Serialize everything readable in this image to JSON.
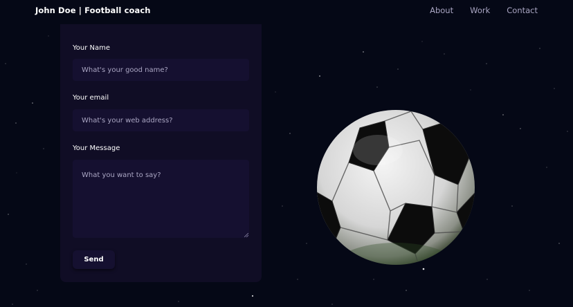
{
  "navbar": {
    "brand": "John Doe  | Football coach",
    "links": [
      "About",
      "Work",
      "Contact"
    ]
  },
  "form": {
    "name": {
      "label": "Your Name",
      "placeholder": "What's your good name?"
    },
    "email": {
      "label": "Your email",
      "placeholder": "What's your web address?"
    },
    "message": {
      "label": "Your Message",
      "placeholder": "What you want to say?"
    },
    "send_label": "Send"
  },
  "colors": {
    "background": "#050816",
    "card": "#100d25",
    "input": "#151030",
    "secondary_text": "#aaa6c3"
  },
  "icons": {
    "hero": "soccer-ball-icon"
  }
}
